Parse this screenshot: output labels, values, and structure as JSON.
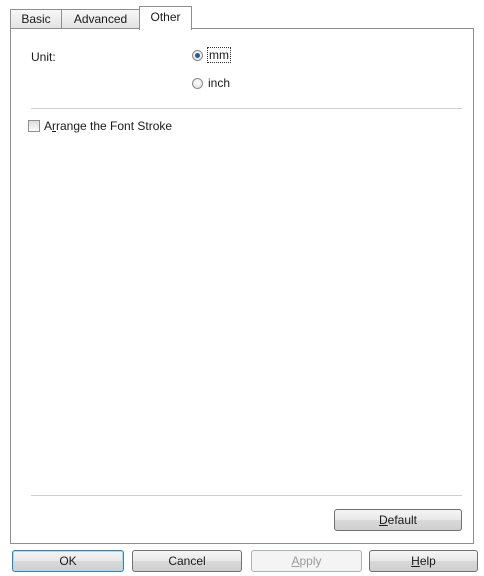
{
  "tabs": [
    {
      "label": "Basic"
    },
    {
      "label": "Advanced"
    },
    {
      "label": "Other"
    }
  ],
  "unit": {
    "label": "Unit:",
    "options": [
      {
        "label": "mm",
        "selected": true
      },
      {
        "label": "inch",
        "selected": false
      }
    ]
  },
  "font_stroke": {
    "label_prefix": "A",
    "label_mnemonic": "r",
    "label_rest": "range the Font Stroke",
    "checked": false
  },
  "buttons": {
    "default": {
      "mnemonic": "D",
      "rest": "efault"
    },
    "ok": "OK",
    "cancel": "Cancel",
    "apply": {
      "mnemonic": "A",
      "rest": "pply"
    },
    "help": {
      "mnemonic": "H",
      "rest": "elp"
    }
  },
  "colors": {
    "radio_dot": "#1c5fb0",
    "primary_border": "#3c7fb1"
  }
}
